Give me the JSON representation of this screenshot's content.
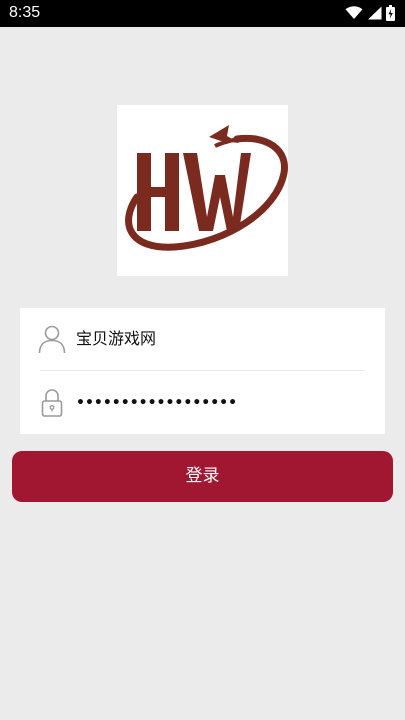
{
  "status_bar": {
    "time": "8:35",
    "icons": [
      "wifi-icon",
      "signal-icon",
      "battery-icon"
    ]
  },
  "logo": {
    "text": "HW",
    "colors": {
      "brand": "#7b2a1f"
    }
  },
  "form": {
    "username": "宝贝游戏网",
    "password_masked": "••••••••••••••••••"
  },
  "login_button": {
    "label": "登录",
    "color": "#a11630"
  }
}
